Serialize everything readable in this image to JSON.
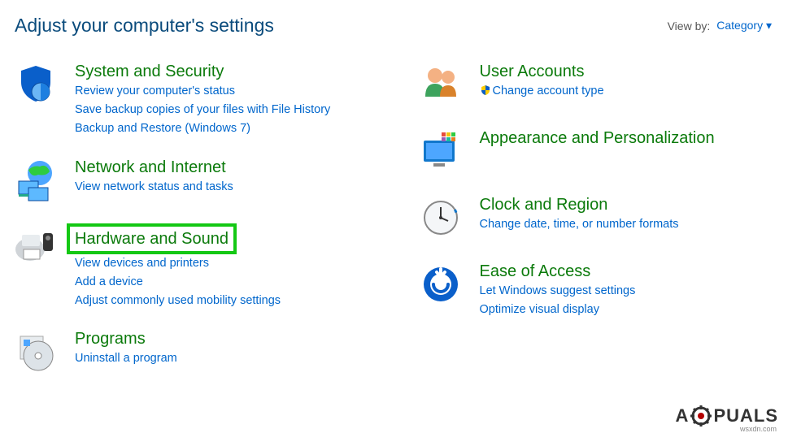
{
  "header": {
    "title": "Adjust your computer's settings",
    "viewby_label": "View by:",
    "viewby_value": "Category"
  },
  "left": [
    {
      "id": "system-security",
      "title": "System and Security",
      "links": [
        "Review your computer's status",
        "Save backup copies of your files with File History",
        "Backup and Restore (Windows 7)"
      ]
    },
    {
      "id": "network-internet",
      "title": "Network and Internet",
      "links": [
        "View network status and tasks"
      ]
    },
    {
      "id": "hardware-sound",
      "title": "Hardware and Sound",
      "highlight": true,
      "links": [
        "View devices and printers",
        "Add a device",
        "Adjust commonly used mobility settings"
      ]
    },
    {
      "id": "programs",
      "title": "Programs",
      "links": [
        "Uninstall a program"
      ]
    }
  ],
  "right": [
    {
      "id": "user-accounts",
      "title": "User Accounts",
      "links": [
        {
          "text": "Change account type",
          "shield": true
        }
      ]
    },
    {
      "id": "appearance",
      "title": "Appearance and Personalization",
      "links": []
    },
    {
      "id": "clock-region",
      "title": "Clock and Region",
      "links": [
        "Change date, time, or number formats"
      ]
    },
    {
      "id": "ease-access",
      "title": "Ease of Access",
      "links": [
        "Let Windows suggest settings",
        "Optimize visual display"
      ]
    }
  ],
  "watermark": {
    "prefix": "A",
    "suffix": "PUALS"
  },
  "source": "wsxdn.com"
}
